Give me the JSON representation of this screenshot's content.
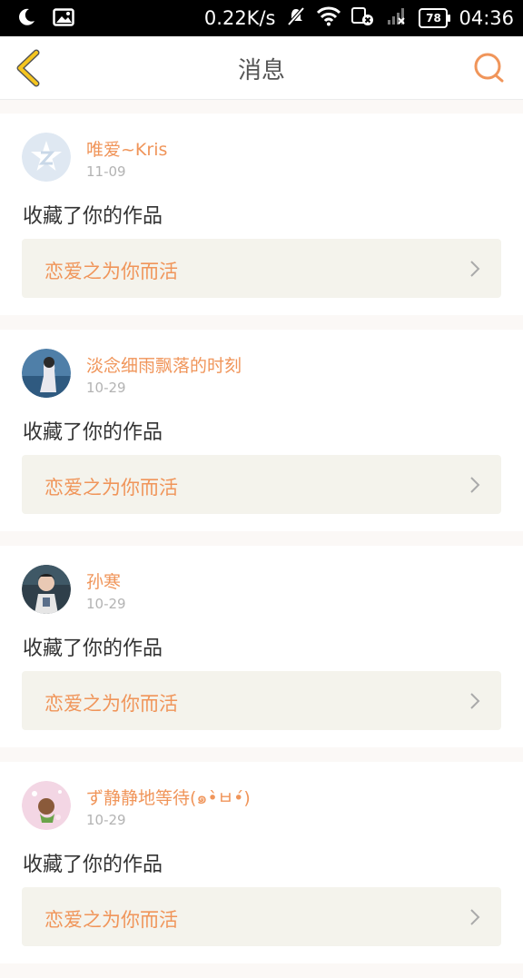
{
  "status_bar": {
    "speed": "0.22K/s",
    "battery": "78",
    "time": "04:36",
    "icons": [
      "moon-icon",
      "image-icon",
      "mute-icon",
      "wifi-icon",
      "sim-icon",
      "signal-icon",
      "battery-icon"
    ]
  },
  "header": {
    "title": "消息",
    "back_icon": "back-chevron-icon",
    "search_icon": "search-icon"
  },
  "colors": {
    "accent": "#f0955a",
    "back_icon": "#f5c51f",
    "card_bg": "#ffffff",
    "page_bg": "#fbf8f6",
    "work_bg": "#f4f3ec"
  },
  "messages": [
    {
      "user": "唯爱~Kris",
      "date": "11-09",
      "action": "收藏了你的作品",
      "work": "恋爱之为你而活",
      "avatar": "default-avatar"
    },
    {
      "user": "淡念细雨飘落的时刻",
      "date": "10-29",
      "action": "收藏了你的作品",
      "work": "恋爱之为你而活",
      "avatar": "photo-avatar"
    },
    {
      "user": "孙寒",
      "date": "10-29",
      "action": "收藏了你的作品",
      "work": "恋爱之为你而活",
      "avatar": "photo-avatar"
    },
    {
      "user": "ず静静地等待(๑•̀ㅂ•́)",
      "date": "10-29",
      "action": "收藏了你的作品",
      "work": "恋爱之为你而活",
      "avatar": "photo-avatar"
    }
  ]
}
